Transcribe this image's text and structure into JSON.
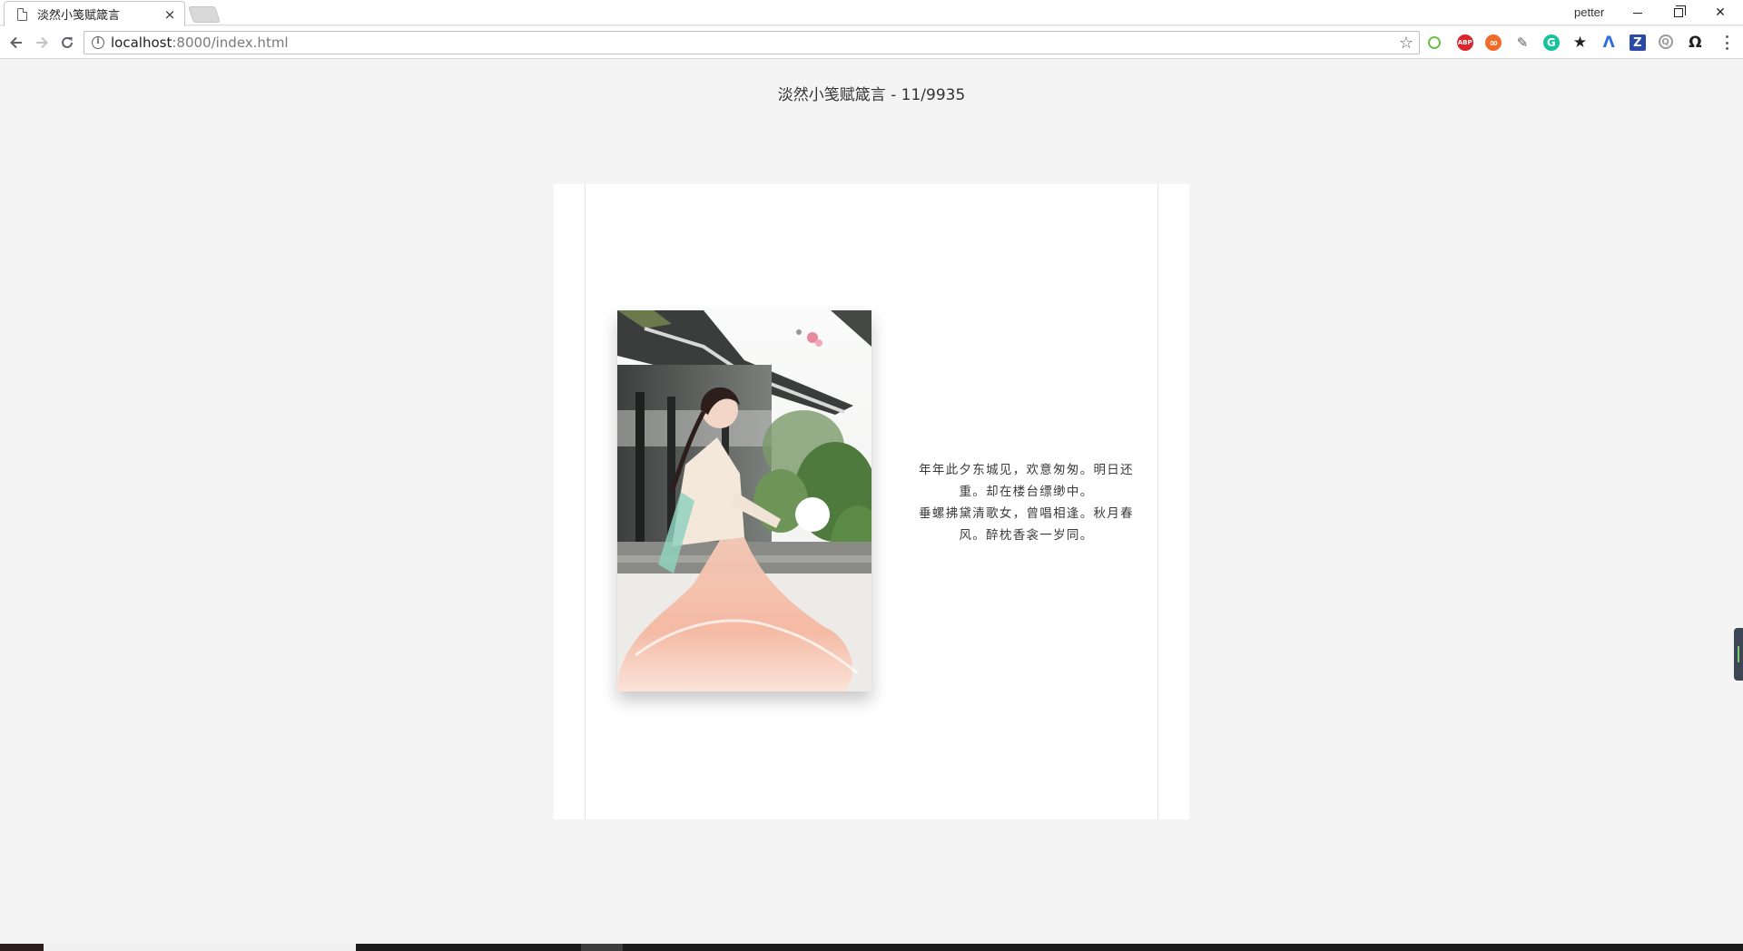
{
  "browser": {
    "tab_title": "淡然小笺赋箴言",
    "tab_close": "×",
    "profile_name": "petter",
    "url_host": "localhost",
    "url_rest": ":8000/index.html",
    "info_glyph": "i",
    "star_glyph": "☆",
    "window_controls": {
      "close_glyph": "✕"
    },
    "extensions": [
      {
        "name": "green-leaf-icon",
        "label": "",
        "color": "#6cc04a"
      },
      {
        "name": "adblock-icon",
        "label": "ABP",
        "color": "#d9262c"
      },
      {
        "name": "infinity-icon",
        "label": "∞",
        "color": "#f06a2a"
      },
      {
        "name": "evernote-icon",
        "label": "✎",
        "color": "#5b5b5b"
      },
      {
        "name": "grammarly-icon",
        "label": "G",
        "color": "#15c39a"
      },
      {
        "name": "bookmark-star-icon",
        "label": "★",
        "color": "#202124"
      },
      {
        "name": "lambda-icon",
        "label": "Λ",
        "color": "#2d6cdf"
      },
      {
        "name": "zotero-icon",
        "label": "Z",
        "color": "#2b4aa8"
      },
      {
        "name": "search-ext-icon",
        "label": "Q",
        "color": "#9a9a9a"
      },
      {
        "name": "github-icon",
        "label": "Ω",
        "color": "#202124"
      }
    ]
  },
  "page": {
    "header": "淡然小笺赋箴言 - 11/9935",
    "poem_lines": [
      "年年此夕东城见，欢意匆匆。明日还重。却在楼台缥缈中。",
      "垂螺拂黛清歌女，曾唱相逢。秋月春风。醉枕香衾一岁同。"
    ]
  }
}
